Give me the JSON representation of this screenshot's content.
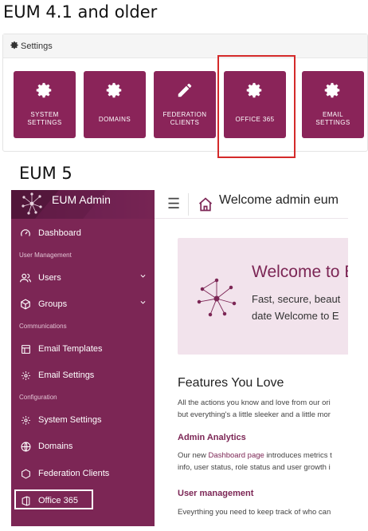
{
  "headings": {
    "old": "EUM 4.1 and older",
    "new": "EUM 5"
  },
  "old_settings": {
    "header": "Settings",
    "tiles": [
      {
        "label": "SYSTEM SETTINGS",
        "icon": "gear-icon"
      },
      {
        "label": "DOMAINS",
        "icon": "gear-icon"
      },
      {
        "label": "FEDERATION CLIENTS",
        "icon": "pencil-icon"
      },
      {
        "label": "OFFICE 365",
        "icon": "gear-icon",
        "highlighted": true
      },
      {
        "label": "EMAIL SETTINGS",
        "icon": "gear-icon"
      }
    ],
    "tile_lines": [
      [
        "SYSTEM",
        "SETTINGS"
      ],
      [
        "DOMAINS"
      ],
      [
        "FEDERATION",
        "CLIENTS"
      ],
      [
        "OFFICE 365"
      ],
      [
        "EMAIL",
        "SETTINGS"
      ]
    ]
  },
  "admin": {
    "brand": "EUM Admin",
    "page_title": "Welcome admin eum",
    "sidebar": {
      "dashboard": "Dashboard",
      "section_user": "User Management",
      "users": "Users",
      "groups": "Groups",
      "section_comm": "Communications",
      "email_templates": "Email Templates",
      "email_settings": "Email Settings",
      "section_config": "Configuration",
      "system_settings": "System Settings",
      "domains": "Domains",
      "federation_clients": "Federation Clients",
      "office365": "Office 365"
    },
    "hero": {
      "title": "Welcome to E",
      "line1": "Fast, secure, beaut",
      "line2": "date Welcome to E"
    },
    "features": {
      "title": "Features You Love",
      "intro_1": "All the actions you know and love from our ori",
      "intro_2": "but everything's a little sleeker and a little mor",
      "analytics_title": "Admin Analytics",
      "analytics_pre": "Our new ",
      "analytics_link": "Dashboard page",
      "analytics_post": " introduces metrics t",
      "analytics_2": "info, user status, role status and user growth i",
      "usermgmt_title": "User management",
      "usermgmt_1": "Eveyrthing you need to keep track of who can"
    }
  },
  "colors": {
    "brand_purple": "#7c2655",
    "tile_purple": "#8a2459",
    "highlight_red": "#d42a2a"
  }
}
